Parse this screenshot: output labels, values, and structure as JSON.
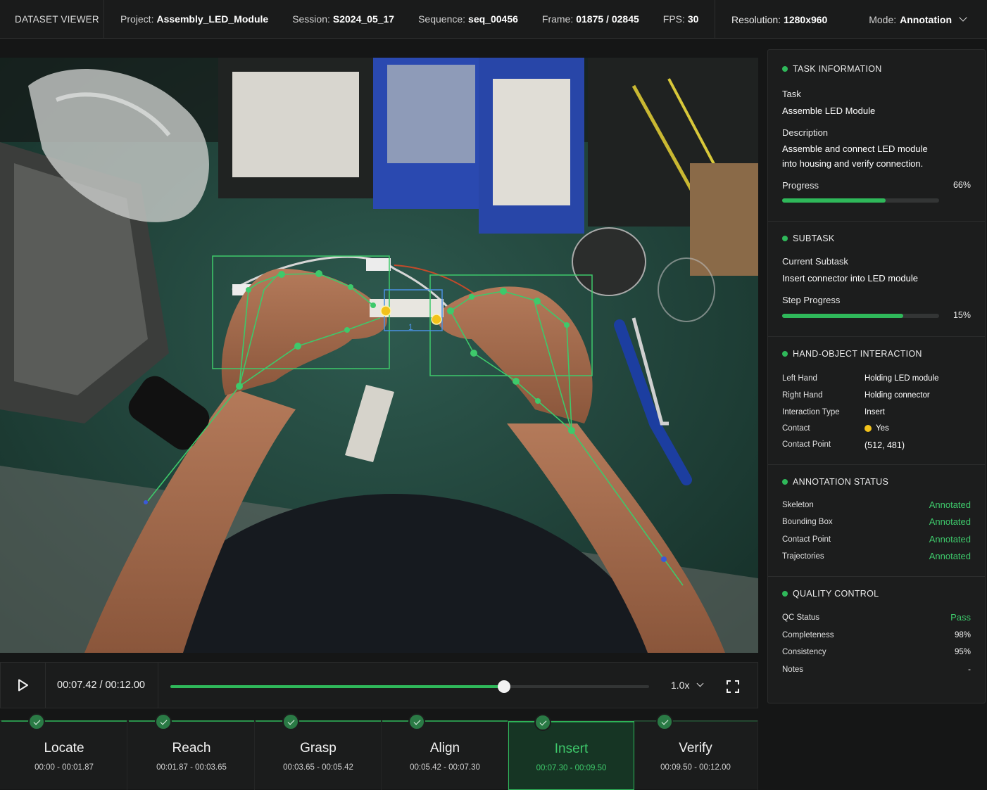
{
  "header": {
    "brand": "DATASET VIEWER",
    "project_label": "Project:",
    "project": "Assembly_LED_Module",
    "session_label": "Session:",
    "session": "S2024_05_17",
    "sequence_label": "Sequence:",
    "sequence": "seq_00456",
    "frame_label": "Frame:",
    "frame": "01875 / 02845",
    "fps_label": "FPS:",
    "fps": "30",
    "resolution_label": "Resolution:",
    "resolution": "1280x960",
    "mode_label": "Mode:",
    "mode": "Annotation"
  },
  "video": {
    "object_id": "1"
  },
  "player": {
    "time": "00:07.42 / 00:12.00",
    "progress": 0.697,
    "speed": "1.0x"
  },
  "steps": [
    {
      "name": "Locate",
      "range": "00:00 - 00:01.87"
    },
    {
      "name": "Reach",
      "range": "00:01.87 - 00:03.65"
    },
    {
      "name": "Grasp",
      "range": "00:03.65 - 00:05.42"
    },
    {
      "name": "Align",
      "range": "00:05.42 - 00:07.30"
    },
    {
      "name": "Insert",
      "range": "00:07.30 - 00:09.50"
    },
    {
      "name": "Verify",
      "range": "00:09.50 - 00:12.00"
    }
  ],
  "active_step": 4,
  "task_info": {
    "title": "TASK INFORMATION",
    "task_label": "Task",
    "task": "Assemble LED Module",
    "description_label": "Description",
    "description_line1": "Assemble and connect LED module",
    "description_line2": "into housing and verify connection.",
    "progress_label": "Progress",
    "progress_text": "66%",
    "progress": 0.66
  },
  "subtask": {
    "title": "SUBTASK",
    "current_label": "Current Subtask",
    "current": "Insert connector into LED module",
    "step_progress_label": "Step Progress",
    "step_progress_text": "15%",
    "step_progress": 0.77
  },
  "hoi": {
    "title": "HAND-OBJECT INTERACTION",
    "rows": [
      {
        "k": "Left Hand",
        "v": "Holding LED module"
      },
      {
        "k": "Right Hand",
        "v": "Holding connector"
      },
      {
        "k": "Interaction Type",
        "v": "Insert"
      },
      {
        "k": "Contact",
        "v": "Yes"
      },
      {
        "k": "Contact Point",
        "v": "(512, 481)"
      }
    ]
  },
  "annotation_status": {
    "title": "ANNOTATION STATUS",
    "rows": [
      {
        "k": "Skeleton",
        "v": "Annotated"
      },
      {
        "k": "Bounding Box",
        "v": "Annotated"
      },
      {
        "k": "Contact Point",
        "v": "Annotated"
      },
      {
        "k": "Trajectories",
        "v": "Annotated"
      }
    ]
  },
  "qc": {
    "title": "QUALITY CONTROL",
    "rows": [
      {
        "k": "QC Status",
        "v": "Pass"
      },
      {
        "k": "Completeness",
        "v": "98%"
      },
      {
        "k": "Consistency",
        "v": "95%"
      },
      {
        "k": "Notes",
        "v": "-"
      }
    ]
  },
  "colors": {
    "accent": "#2fb85a",
    "contact": "#f2c21b",
    "bbox_object": "#4a90e2"
  }
}
